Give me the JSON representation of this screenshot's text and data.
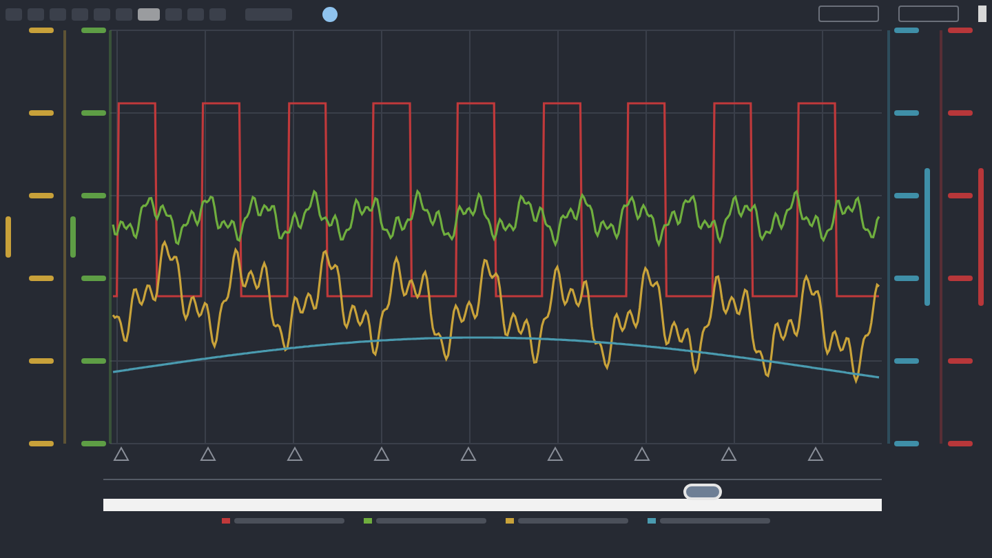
{
  "toolbar": {
    "buttons": [
      {
        "selected": false
      },
      {
        "selected": false
      },
      {
        "selected": false
      },
      {
        "selected": false
      },
      {
        "selected": false
      },
      {
        "selected": false
      },
      {
        "selected": true
      },
      {
        "selected": false
      },
      {
        "selected": false
      },
      {
        "selected": false
      }
    ]
  },
  "axes": {
    "left": [
      {
        "color": "#c8a13a"
      },
      {
        "color": "#5e9e45"
      }
    ],
    "right": [
      {
        "color": "#3f8fa8"
      },
      {
        "color": "#b8373a"
      }
    ]
  },
  "series": [
    {
      "kind": "square",
      "color": "#c0393b"
    },
    {
      "kind": "noisy-high",
      "color": "#6fae3e"
    },
    {
      "kind": "noisy-low",
      "color": "#c9a33a"
    },
    {
      "kind": "smooth",
      "color": "#4a9bb0"
    }
  ],
  "navigator": {
    "level": 0.77
  }
}
